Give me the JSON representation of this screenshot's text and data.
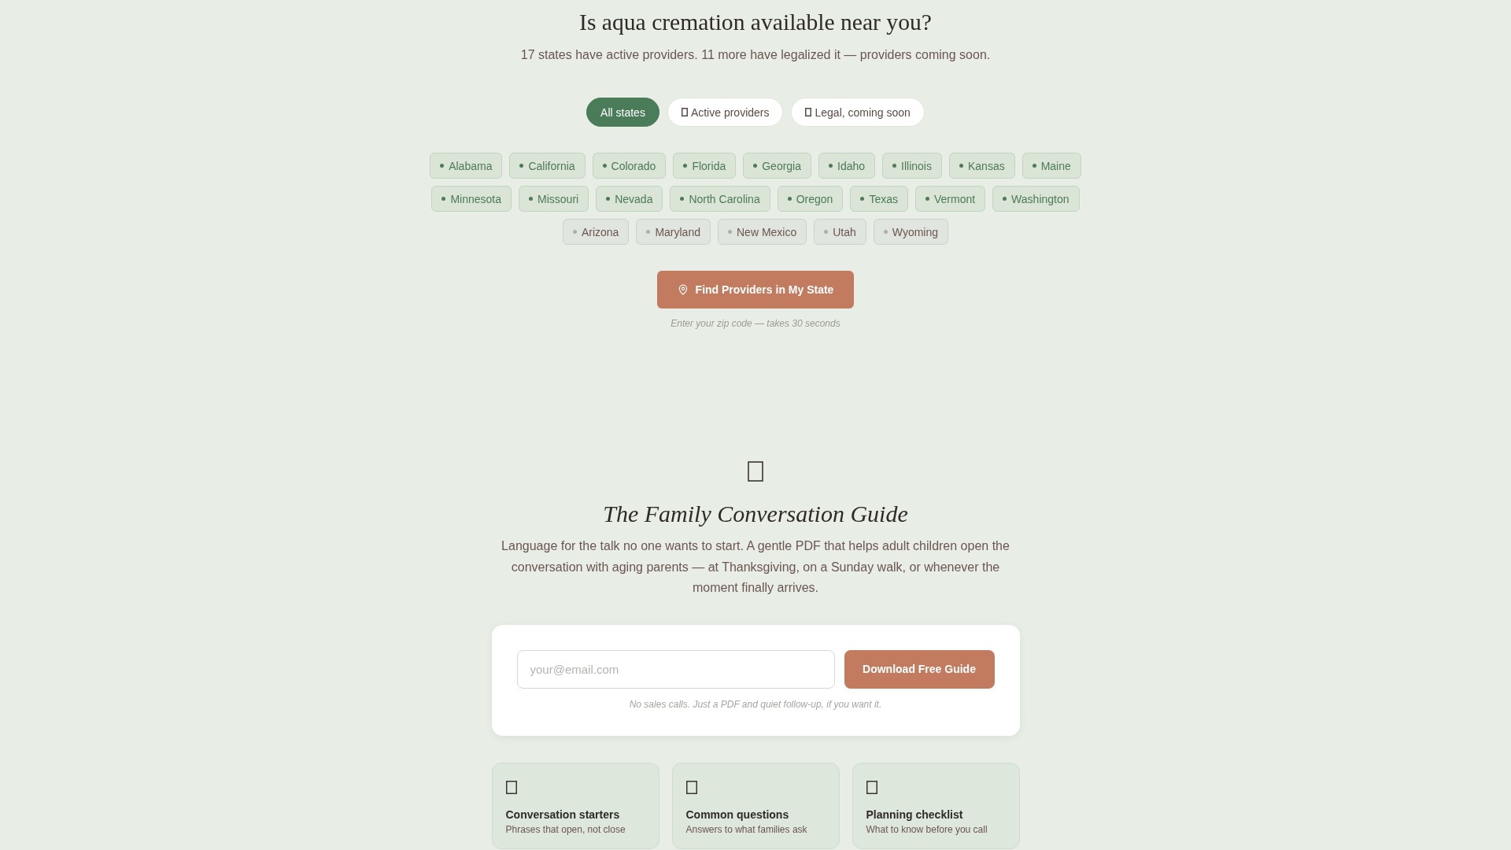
{
  "header": {
    "title": "Is aqua cremation available near you?",
    "subtitle": "17 states have active providers. 11 more have legalized it — providers coming soon."
  },
  "filters": [
    {
      "label": "All states",
      "kind": "all",
      "selected": true
    },
    {
      "label": "Active providers",
      "kind": "active",
      "selected": false
    },
    {
      "label": "Legal, coming soon",
      "kind": "legal",
      "selected": false
    }
  ],
  "state_rows": [
    [
      {
        "name": "Alabama",
        "kind": "active"
      },
      {
        "name": "California",
        "kind": "active"
      },
      {
        "name": "Colorado",
        "kind": "active"
      },
      {
        "name": "Florida",
        "kind": "active"
      },
      {
        "name": "Georgia",
        "kind": "active"
      },
      {
        "name": "Idaho",
        "kind": "active"
      },
      {
        "name": "Illinois",
        "kind": "active"
      },
      {
        "name": "Kansas",
        "kind": "active"
      },
      {
        "name": "Maine",
        "kind": "active"
      }
    ],
    [
      {
        "name": "Minnesota",
        "kind": "active"
      },
      {
        "name": "Missouri",
        "kind": "active"
      },
      {
        "name": "Nevada",
        "kind": "active"
      },
      {
        "name": "North Carolina",
        "kind": "active"
      },
      {
        "name": "Oregon",
        "kind": "active"
      },
      {
        "name": "Texas",
        "kind": "active"
      },
      {
        "name": "Vermont",
        "kind": "active"
      },
      {
        "name": "Washington",
        "kind": "active"
      }
    ],
    [
      {
        "name": "Arizona",
        "kind": "legal"
      },
      {
        "name": "Maryland",
        "kind": "legal"
      },
      {
        "name": "New Mexico",
        "kind": "legal"
      },
      {
        "name": "Utah",
        "kind": "legal"
      },
      {
        "name": "Wyoming",
        "kind": "legal"
      }
    ]
  ],
  "cta": {
    "label": "Find Providers in My State",
    "hint": "Enter your zip code — takes 30 seconds"
  },
  "guide": {
    "title": "The Family Conversation Guide",
    "description": "Language for the talk no one wants to start. A gentle PDF that helps adult children open the conversation with aging parents — at Thanksgiving, on a Sunday walk, or whenever the moment finally arrives."
  },
  "signup": {
    "email_field": {
      "placeholder": "your@email.com"
    },
    "button": "Download Free Guide",
    "note": "No sales calls. Just a PDF and quiet follow-up, if you want it."
  },
  "features": [
    {
      "title": "Conversation starters",
      "description": "Phrases that open, not close"
    },
    {
      "title": "Common questions",
      "description": "Answers to what families ask"
    },
    {
      "title": "Planning checklist",
      "description": "What to know before you call"
    }
  ]
}
